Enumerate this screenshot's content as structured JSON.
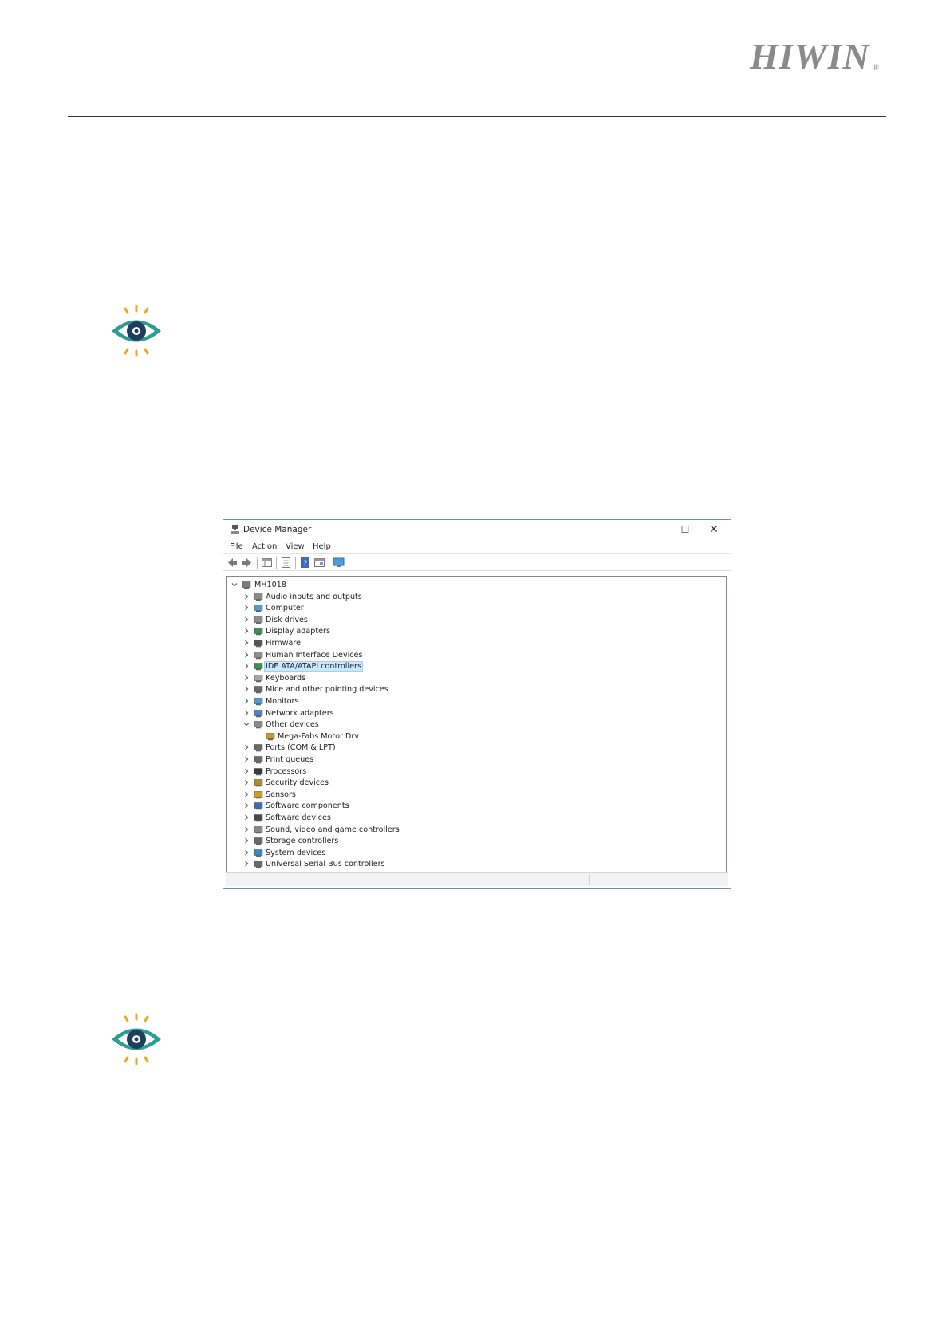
{
  "header": {
    "brand": "HIWIN",
    "reg_mark": "®"
  },
  "window": {
    "title": "Device Manager",
    "minimize": "—",
    "maximize": "☐",
    "close": "✕"
  },
  "menu": {
    "file": "File",
    "action": "Action",
    "view": "View",
    "help": "Help"
  },
  "toolbar_icons": [
    "back-arrow-icon",
    "forward-arrow-icon",
    "show-hide-tree-icon",
    "properties-icon",
    "help-icon",
    "device-view-icon",
    "monitor-icon"
  ],
  "tree": {
    "root": {
      "label": "MH1018",
      "icon": "computer-tree-icon",
      "expanded": true
    },
    "categories": [
      {
        "label": "Audio inputs and outputs",
        "icon": "speaker-icon"
      },
      {
        "label": "Computer",
        "icon": "computer-icon"
      },
      {
        "label": "Disk drives",
        "icon": "disk-drive-icon"
      },
      {
        "label": "Display adapters",
        "icon": "display-adapter-icon"
      },
      {
        "label": "Firmware",
        "icon": "chip-icon"
      },
      {
        "label": "Human Interface Devices",
        "icon": "hid-icon"
      },
      {
        "label": "IDE ATA/ATAPI controllers",
        "icon": "ide-controller-icon",
        "selected": true
      },
      {
        "label": "Keyboards",
        "icon": "keyboard-icon"
      },
      {
        "label": "Mice and other pointing devices",
        "icon": "mouse-icon"
      },
      {
        "label": "Monitors",
        "icon": "monitor-icon"
      },
      {
        "label": "Network adapters",
        "icon": "network-adapter-icon"
      },
      {
        "label": "Other devices",
        "icon": "unknown-device-icon",
        "expanded": true,
        "children": [
          {
            "label": "Mega-Fabs Motor Drv",
            "icon": "warning-device-icon"
          }
        ]
      },
      {
        "label": "Ports (COM & LPT)",
        "icon": "port-icon"
      },
      {
        "label": "Print queues",
        "icon": "printer-icon"
      },
      {
        "label": "Processors",
        "icon": "processor-icon"
      },
      {
        "label": "Security devices",
        "icon": "security-device-icon"
      },
      {
        "label": "Sensors",
        "icon": "sensor-icon"
      },
      {
        "label": "Software components",
        "icon": "software-component-icon"
      },
      {
        "label": "Software devices",
        "icon": "software-device-icon"
      },
      {
        "label": "Sound, video and game controllers",
        "icon": "sound-controller-icon"
      },
      {
        "label": "Storage controllers",
        "icon": "storage-controller-icon"
      },
      {
        "label": "System devices",
        "icon": "system-devices-icon"
      },
      {
        "label": "Universal Serial Bus controllers",
        "icon": "usb-icon"
      }
    ]
  },
  "colors": {
    "eye_teal": "#2d9c93",
    "eye_dark": "#1f3e5c",
    "eye_rays": "#f2a51f",
    "selection": "#cce8ff",
    "window_border": "#6e8fb5"
  }
}
